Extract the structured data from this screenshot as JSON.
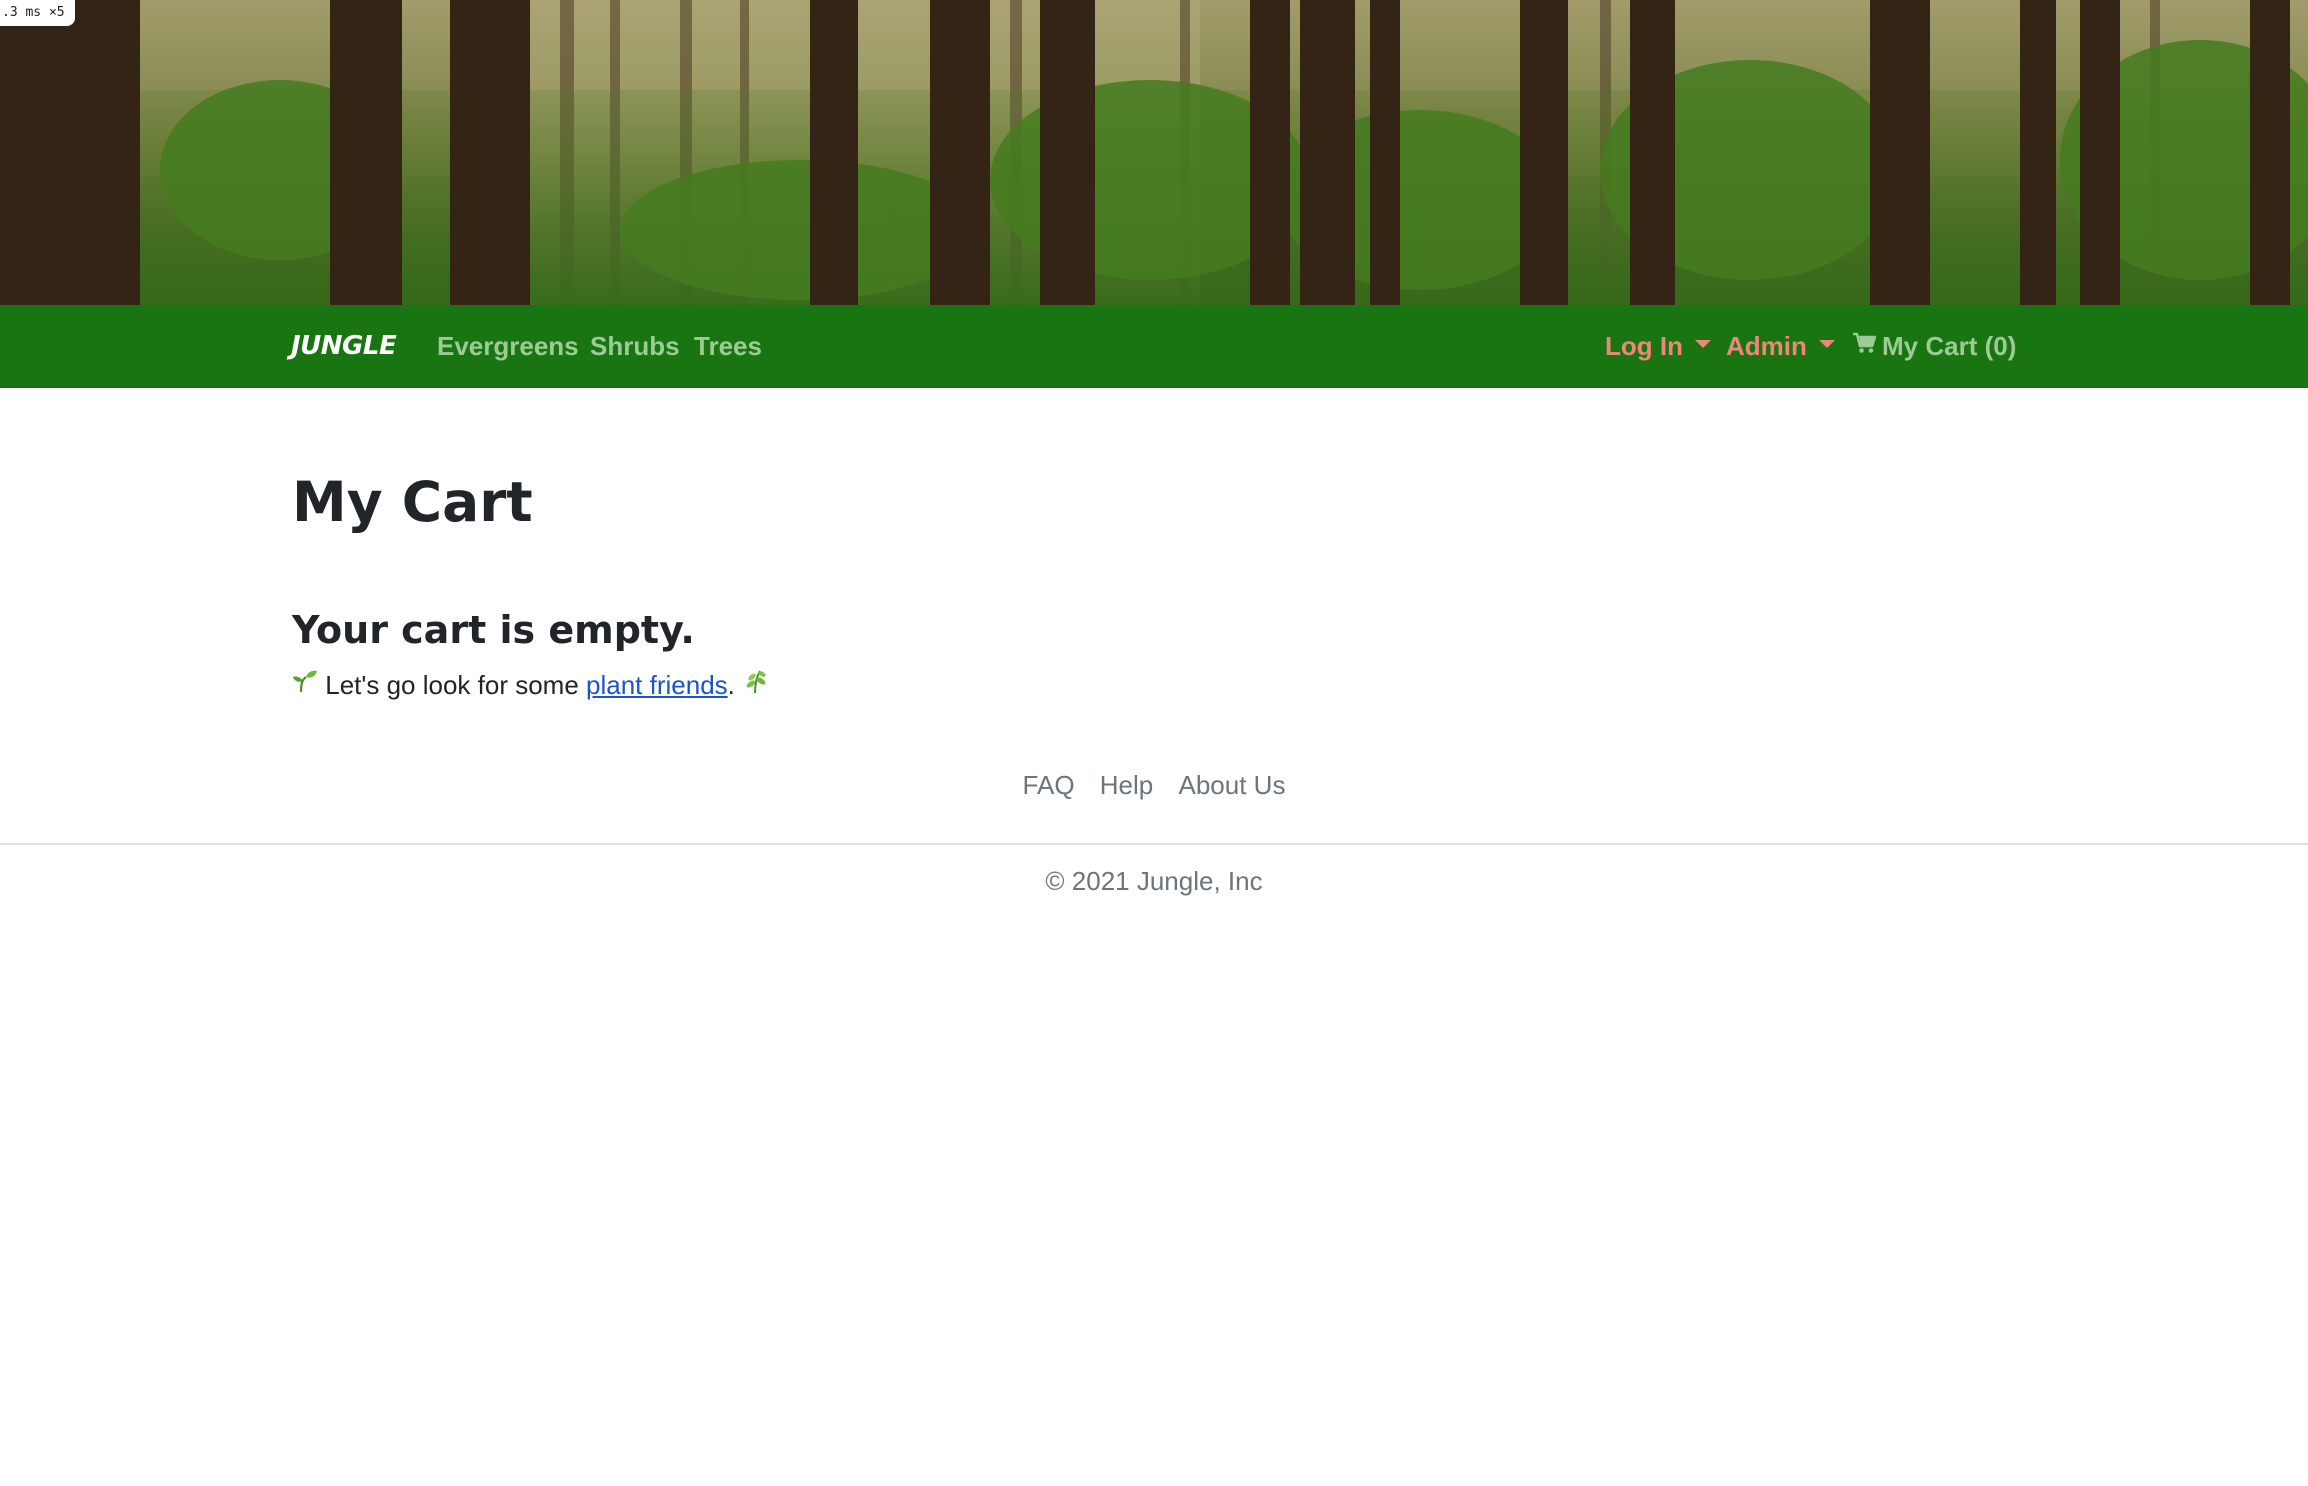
{
  "perf_badge": ".3 ms ×5",
  "navbar": {
    "brand": "JUNGLE",
    "links": [
      "Evergreens",
      "Shrubs",
      "Trees"
    ],
    "login_label": "Log In",
    "admin_label": "Admin",
    "cart_label": "My Cart (0)"
  },
  "main": {
    "title": "My Cart",
    "empty_title": "Your cart is empty.",
    "empty_text_before": "Let's go look for some",
    "empty_link": "plant friends",
    "empty_text_after": "."
  },
  "footer": {
    "links": [
      "FAQ",
      "Help",
      "About Us"
    ],
    "copyright": "© 2021 Jungle, Inc"
  },
  "colors": {
    "navbar_bg": "#187511",
    "nav_link": "#9ccb95",
    "dropdown": "#f0857a",
    "link": "#1a55c9",
    "text": "#212529",
    "muted": "#6c757d"
  },
  "icons": [
    "cart-icon",
    "sprout-icon",
    "herb-icon",
    "caret-down-icon"
  ]
}
